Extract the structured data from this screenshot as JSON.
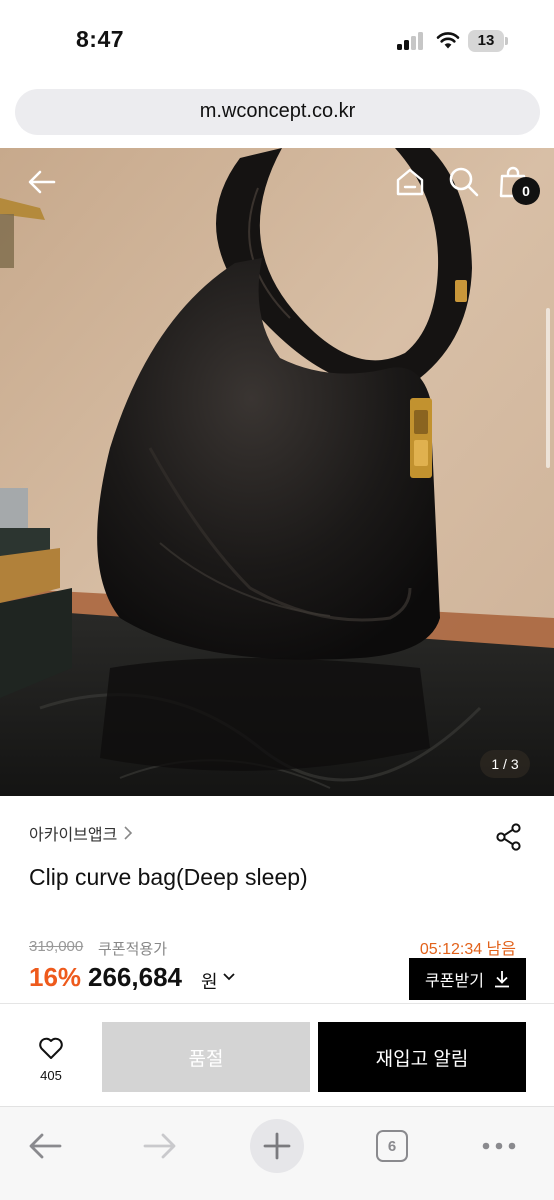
{
  "status_bar": {
    "time": "8:47",
    "battery_percent": "13",
    "battery_level": 0.13,
    "signal_bars_active": 2,
    "icons": [
      "signal-icon",
      "wifi-icon",
      "battery-icon"
    ]
  },
  "browser": {
    "url": "m.wconcept.co.kr",
    "toolbar_icons": [
      "back-arrow-icon",
      "forward-arrow-icon",
      "new-tab-plus-icon",
      "tabs-icon",
      "more-icon"
    ],
    "tab_count": "6"
  },
  "header_icons": [
    "back-arrow-icon",
    "home-icon",
    "search-icon",
    "shopping-bag-icon"
  ],
  "cart_count": "0",
  "gallery": {
    "counter": "1 / 3",
    "current": 1,
    "total": 3
  },
  "product": {
    "brand": "아카이브앱크",
    "title": "Clip curve bag(Deep sleep)",
    "original_price": "319,000",
    "coupon_label": "쿠폰적용가",
    "timer": "05:12:34 남음",
    "discount": "16%",
    "price": "266,684",
    "price_unit": "원",
    "coupon_button": "쿠폰받기"
  },
  "actions": {
    "like_count": "405",
    "soldout_label": "품절",
    "restock_label": "재입고 알림"
  },
  "colors": {
    "discount": "#ee5a1c",
    "timer": "#e2621b",
    "primary_button": "#000000",
    "disabled_button": "#d4d4d4"
  }
}
